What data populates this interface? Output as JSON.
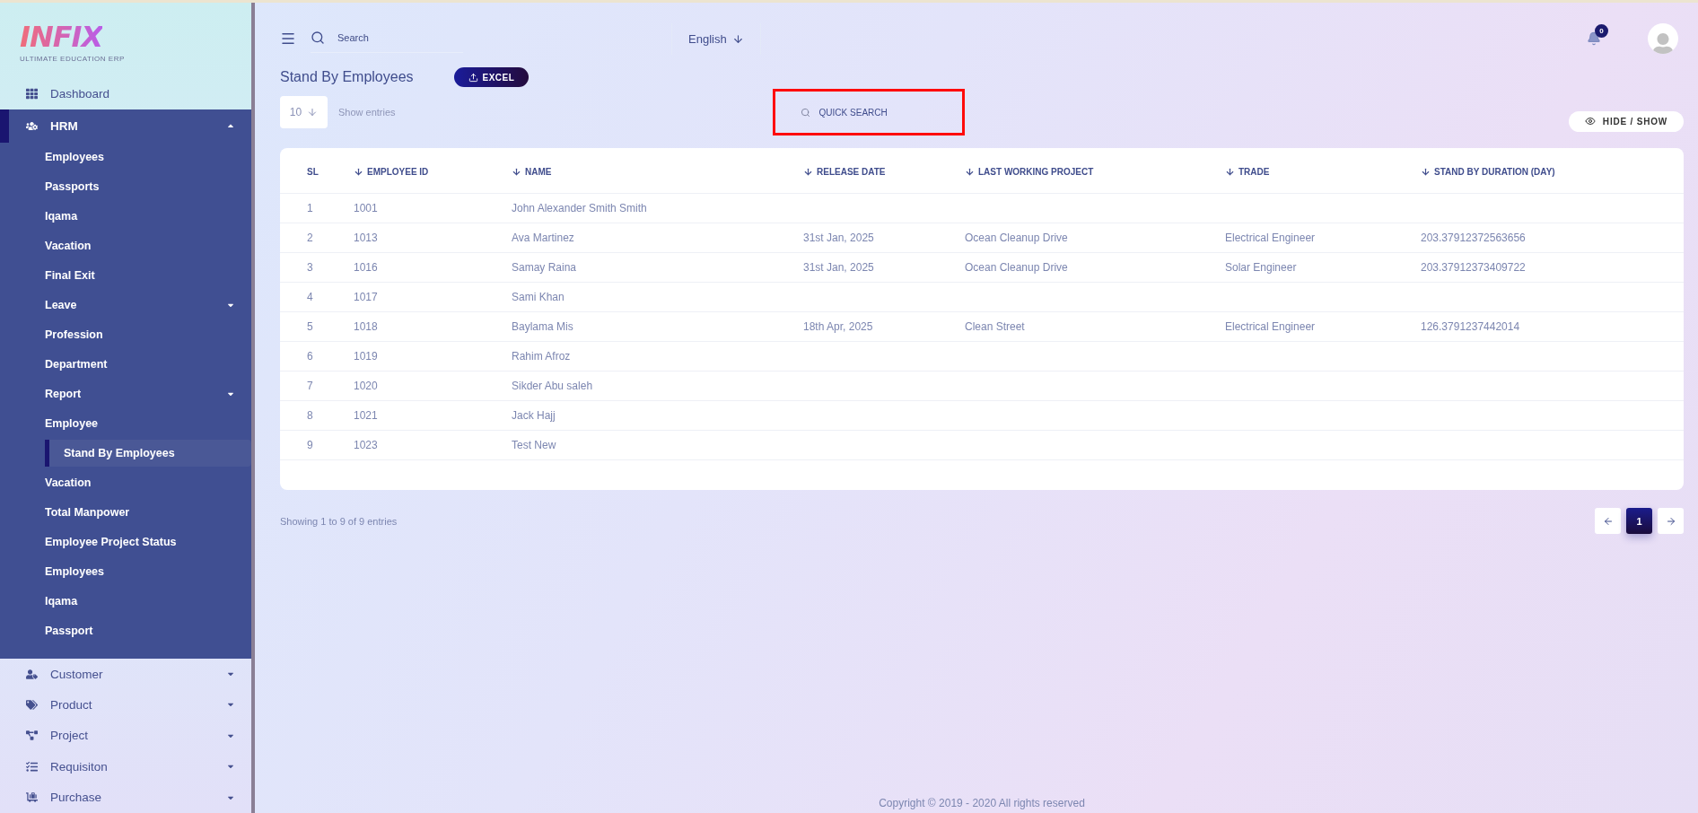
{
  "logo": {
    "name": "INFIX",
    "tagline": "ULTIMATE EDUCATION ERP"
  },
  "sidebar": {
    "items": [
      {
        "label": "Dashboard",
        "selected": false
      },
      {
        "label": "HRM",
        "selected": true,
        "expanded": true,
        "children": [
          {
            "label": "Employees",
            "selected": false
          },
          {
            "label": "Passports",
            "selected": false
          },
          {
            "label": "Iqama",
            "selected": false
          },
          {
            "label": "Vacation",
            "selected": false
          },
          {
            "label": "Final Exit",
            "selected": false
          },
          {
            "label": "Leave",
            "selected": false,
            "expanded": false
          },
          {
            "label": "Profession",
            "selected": false
          },
          {
            "label": "Department",
            "selected": false
          },
          {
            "label": "Report",
            "selected": false,
            "expanded": false
          },
          {
            "label": "Employee",
            "selected": false,
            "children": [
              {
                "label": "Stand By Employees",
                "selected": true
              }
            ]
          },
          {
            "label": "Vacation",
            "selected": false
          },
          {
            "label": "Total Manpower",
            "selected": false
          },
          {
            "label": "Employee Project Status",
            "selected": false
          },
          {
            "label": "Employees",
            "selected": false
          },
          {
            "label": "Iqama",
            "selected": false
          },
          {
            "label": "Passport",
            "selected": false
          }
        ]
      },
      {
        "label": "Customer",
        "selected": false,
        "expanded": false
      },
      {
        "label": "Product",
        "selected": false,
        "expanded": false
      },
      {
        "label": "Project",
        "selected": false,
        "expanded": false
      },
      {
        "label": "Requisiton",
        "selected": false,
        "expanded": false
      },
      {
        "label": "Purchase",
        "selected": false,
        "expanded": false
      }
    ]
  },
  "header": {
    "search": {
      "placeholder": "Search"
    },
    "language": "English",
    "notifications": "0"
  },
  "page": {
    "title": "Stand By Employees",
    "export_button": "EXCEL",
    "entries": {
      "value": "10",
      "label": "Show entries"
    },
    "quick_search": {
      "placeholder": "QUICK SEARCH",
      "highlighted": true
    },
    "hide_show_button": "HIDE / SHOW"
  },
  "table": {
    "columns": [
      {
        "label": "SL",
        "sortable": false
      },
      {
        "label": "EMPLOYEE ID",
        "sortable": true
      },
      {
        "label": "NAME",
        "sortable": true
      },
      {
        "label": "RELEASE DATE",
        "sortable": true
      },
      {
        "label": "LAST WORKING PROJECT",
        "sortable": true
      },
      {
        "label": "TRADE",
        "sortable": true
      },
      {
        "label": "STAND BY DURATION (DAY)",
        "sortable": true
      }
    ],
    "rows": [
      [
        "1",
        "1001",
        "John Alexander Smith Smith",
        null,
        null,
        null,
        null
      ],
      [
        "2",
        "1013",
        "Ava Martinez",
        "31st Jan, 2025",
        "Ocean Cleanup Drive",
        "Electrical Engineer",
        "203.37912372563656"
      ],
      [
        "3",
        "1016",
        "Samay Raina",
        "31st Jan, 2025",
        "Ocean Cleanup Drive",
        "Solar Engineer",
        "203.37912373409722"
      ],
      [
        "4",
        "1017",
        "Sami Khan",
        null,
        null,
        null,
        null
      ],
      [
        "5",
        "1018",
        "Baylama Mis",
        "18th Apr, 2025",
        "Clean Street",
        "Electrical Engineer",
        "126.3791237442014"
      ],
      [
        "6",
        "1019",
        "Rahim Afroz",
        null,
        null,
        null,
        null
      ],
      [
        "7",
        "1020",
        "Sikder Abu saleh",
        null,
        null,
        null,
        null
      ],
      [
        "8",
        "1021",
        "Jack Hajj",
        null,
        null,
        null,
        null
      ],
      [
        "9",
        "1023",
        "Test New",
        null,
        null,
        null,
        null
      ]
    ]
  },
  "table_info": "Showing 1 to 9 of 9 entries",
  "pagination": {
    "pages": [
      {
        "label": "1",
        "selected": true
      }
    ]
  },
  "footer": "Copyright © 2019 - 2020 All rights reserved"
}
